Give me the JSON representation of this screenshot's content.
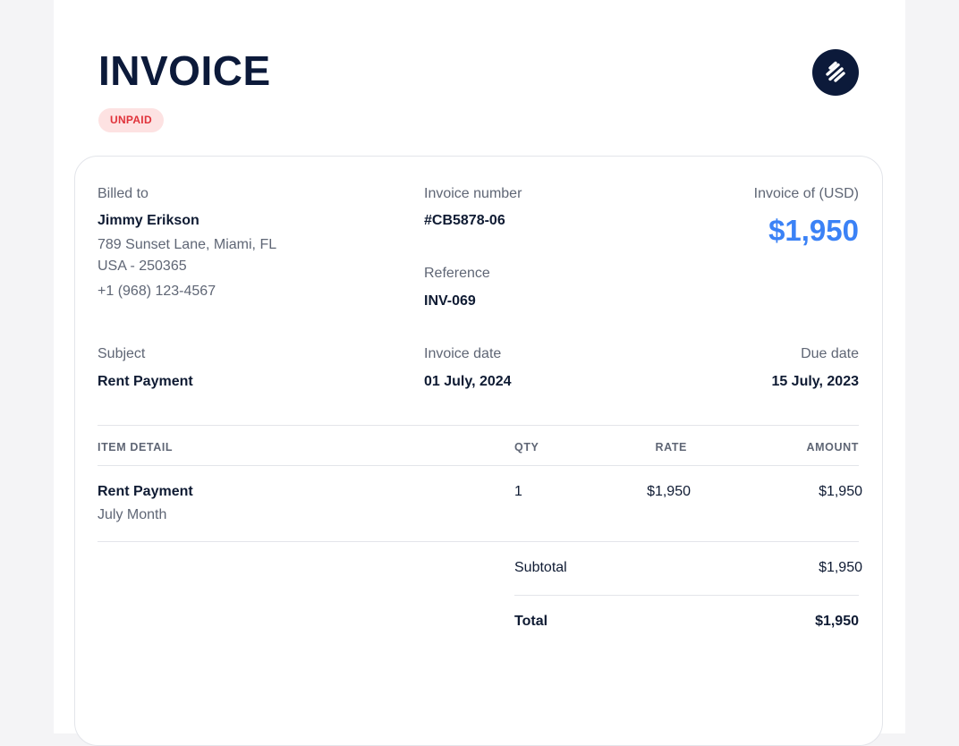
{
  "header": {
    "title": "INVOICE",
    "status": "UNPAID",
    "logo_icon": "brand-logo-icon"
  },
  "billed_to": {
    "label": "Billed to",
    "name": "Jimmy Erikson",
    "address_line1": "789 Sunset Lane, Miami, FL",
    "address_line2": "USA - 250365",
    "phone": "+1 (968) 123-4567"
  },
  "invoice_number": {
    "label": "Invoice number",
    "value": "#CB5878-06"
  },
  "reference": {
    "label": "Reference",
    "value": "INV-069"
  },
  "invoice_total": {
    "label": "Invoice of (USD)",
    "value": "$1,950"
  },
  "subject": {
    "label": "Subject",
    "value": "Rent Payment"
  },
  "invoice_date": {
    "label": "Invoice date",
    "value": "01 July, 2024"
  },
  "due_date": {
    "label": "Due date",
    "value": "15 July, 2023"
  },
  "table": {
    "headers": {
      "item": "ITEM DETAIL",
      "qty": "QTY",
      "rate": "RATE",
      "amount": "AMOUNT"
    },
    "rows": [
      {
        "item": "Rent Payment",
        "description": "July Month",
        "qty": "1",
        "rate": "$1,950",
        "amount": "$1,950"
      }
    ]
  },
  "summary": {
    "subtotal_label": "Subtotal",
    "subtotal_value": "$1,950",
    "total_label": "Total",
    "total_value": "$1,950"
  },
  "colors": {
    "accent": "#3b82f6",
    "navy": "#0c1a3a",
    "unpaid_text": "#e0323a",
    "unpaid_bg": "#fde2e2"
  }
}
